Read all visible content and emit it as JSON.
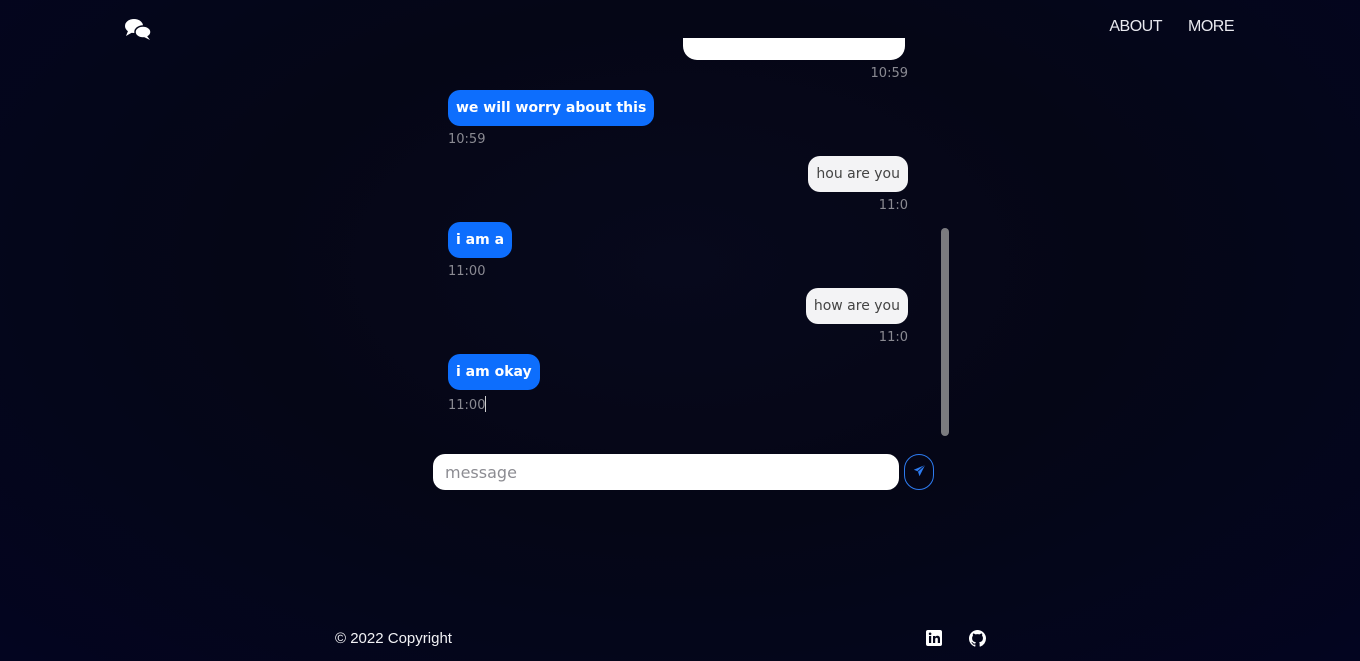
{
  "header": {
    "nav": [
      {
        "label": "ABOUT"
      },
      {
        "label": "MORE"
      }
    ]
  },
  "chat": {
    "messages": [
      {
        "side": "right",
        "text": "",
        "time": "10:59"
      },
      {
        "side": "left",
        "text": "we will worry about this",
        "time": "10:59"
      },
      {
        "side": "right",
        "text": "hou are you",
        "time": "11:0"
      },
      {
        "side": "left",
        "text": "i am a",
        "time": "11:00"
      },
      {
        "side": "right",
        "text": "how are you",
        "time": "11:0"
      },
      {
        "side": "left",
        "text": "i am okay",
        "time": "11:00"
      }
    ]
  },
  "composer": {
    "placeholder": "message",
    "value": ""
  },
  "footer": {
    "copyright": "© 2022 Copyright"
  },
  "colors": {
    "incoming_bubble": "#0d6efd",
    "outgoing_bubble": "#f3f3f5",
    "accent": "#2d7bf0"
  }
}
